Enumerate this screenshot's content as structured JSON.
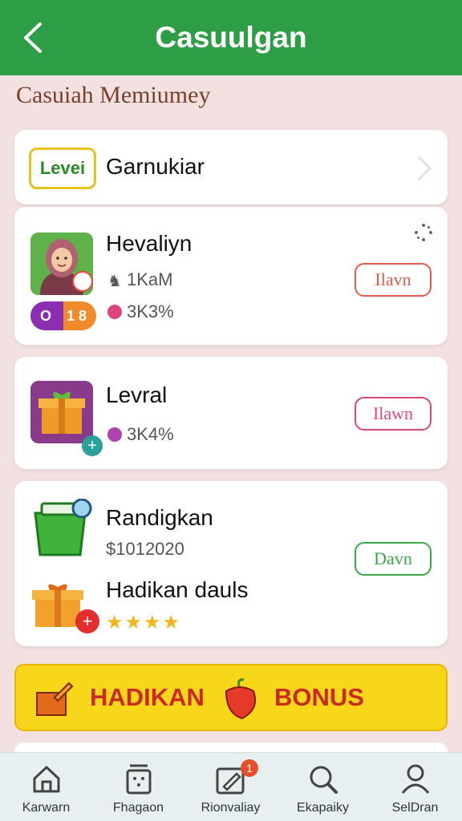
{
  "header": {
    "title": "Casuulgan",
    "back_icon": "chevron-left-icon"
  },
  "section_title": "Casuiah Memiumey",
  "level_row": {
    "badge": "Levei",
    "label": "Garnukiar"
  },
  "cards": [
    {
      "title": "Hevaliyn",
      "meta1": "1KaM",
      "meta2": "3K3%",
      "level_badge": "O   1 8",
      "button": "Ilavn",
      "button_color": "#e25a4e"
    },
    {
      "title": "Levral",
      "meta1": "3K4%",
      "button": "Ilawn",
      "button_color": "#e0447d"
    }
  ],
  "combo_card": {
    "item1": {
      "title": "Randigkan",
      "meta": "$1012020",
      "button": "Davn",
      "button_color": "#3aa84a"
    },
    "item2": {
      "title": "Hadikan dauls",
      "stars": "★★★★"
    }
  },
  "bonus": {
    "left": "HADIKAN",
    "right": "BONUS"
  },
  "nav": [
    {
      "label": "Karwarn",
      "icon": "home-icon"
    },
    {
      "label": "Fhagaon",
      "icon": "basket-icon"
    },
    {
      "label": "Rionvaliay",
      "icon": "edit-icon",
      "badge": "1"
    },
    {
      "label": "Ekapaiky",
      "icon": "search-icon"
    },
    {
      "label": "SelDran",
      "icon": "profile-icon"
    }
  ]
}
